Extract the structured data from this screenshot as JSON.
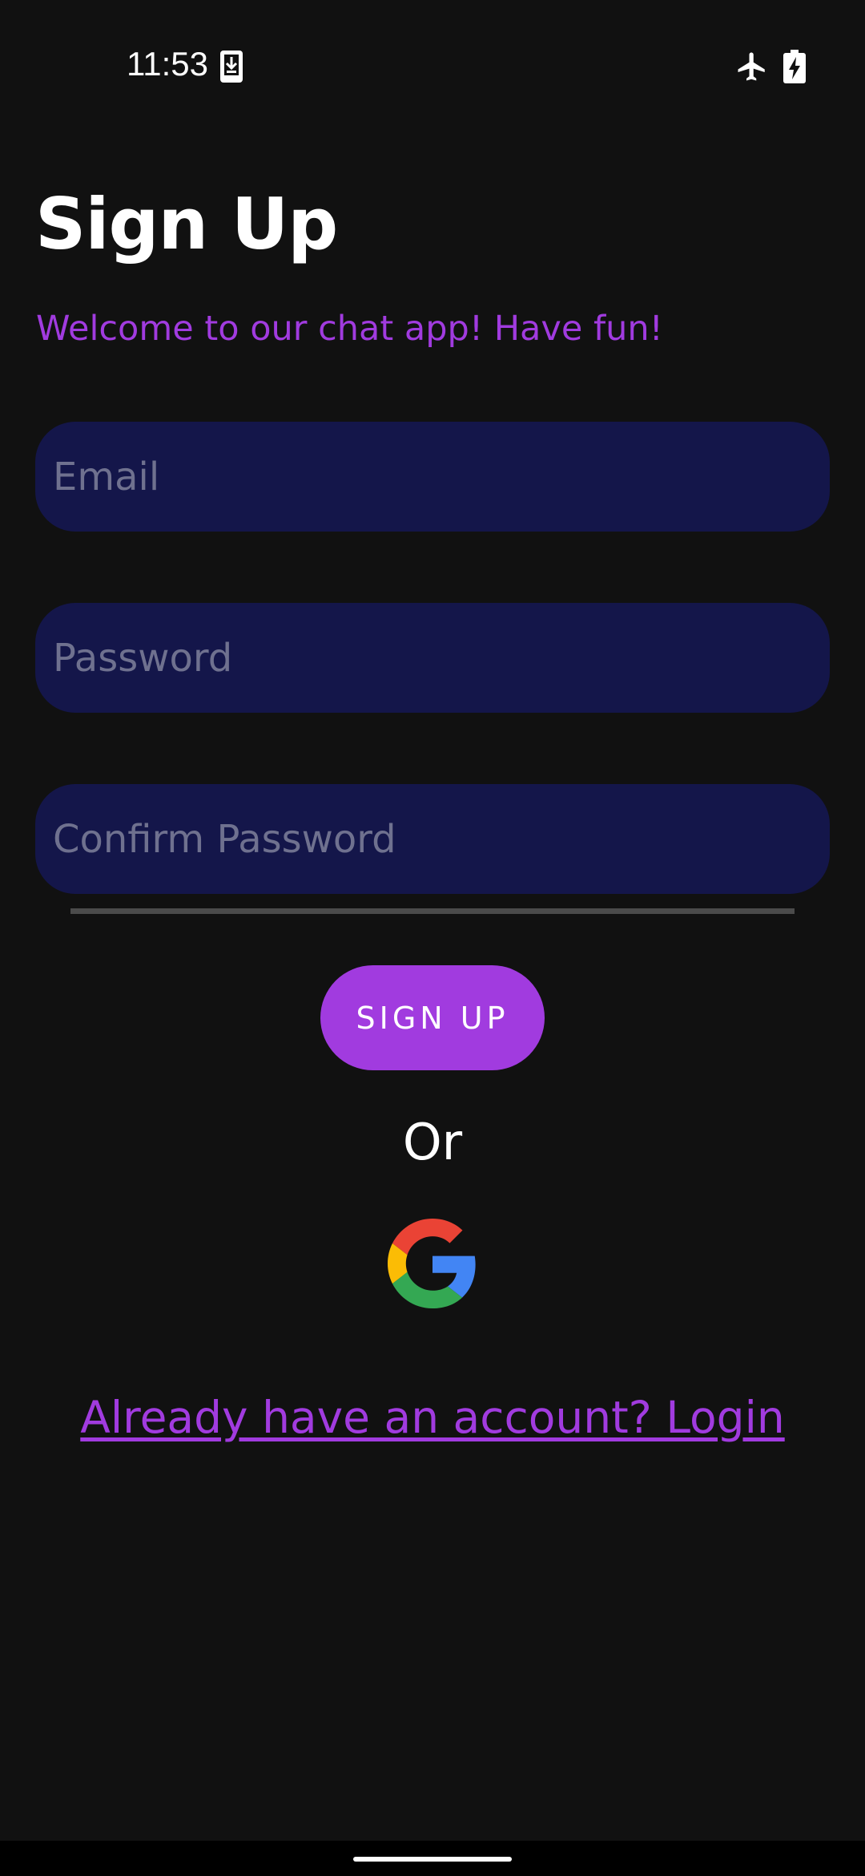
{
  "status_bar": {
    "time": "11:53",
    "icons": [
      "download-icon",
      "airplane-mode-icon",
      "battery-charging-icon"
    ]
  },
  "header": {
    "title": "Sign Up",
    "subtitle": "Welcome to our chat app! Have fun!"
  },
  "form": {
    "email": {
      "placeholder": "Email",
      "value": ""
    },
    "password": {
      "placeholder": "Password",
      "value": ""
    },
    "confirm_password": {
      "placeholder": "Confirm Password",
      "value": ""
    },
    "signup_label": "SIGN UP"
  },
  "alt": {
    "or_label": "Or",
    "google_icon": "google-icon"
  },
  "footer": {
    "login_link": "Already have an account? Login"
  },
  "colors": {
    "background": "#111111",
    "accent": "#a13bdf",
    "field_bg": "#14164a",
    "placeholder": "#6f718f"
  }
}
